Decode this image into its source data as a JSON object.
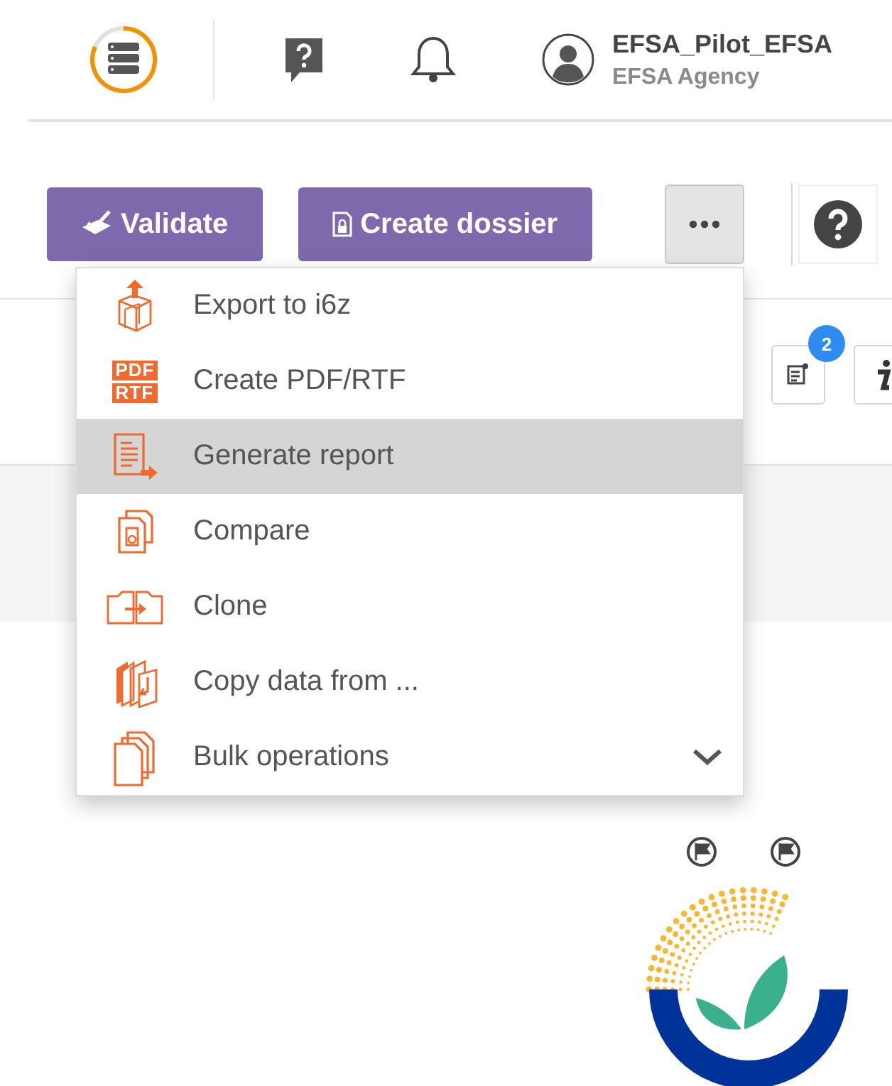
{
  "header": {
    "user_name": "EFSA_Pilot_EFSA",
    "organisation": "EFSA Agency"
  },
  "toolbar": {
    "buttons": [
      {
        "label": "Validate",
        "kind": "validate"
      },
      {
        "label": "Create dossier",
        "kind": "dossier"
      }
    ]
  },
  "side_tools": {
    "badge": "2"
  },
  "menu": {
    "items": [
      {
        "label": "Export to i6z",
        "kind": "export",
        "selected": false
      },
      {
        "label": "Create PDF/RTF",
        "kind": "pdf",
        "selected": false,
        "icon_lines": [
          "PDF",
          "RTF"
        ]
      },
      {
        "label": "Generate report",
        "kind": "report",
        "selected": true
      },
      {
        "label": "Compare",
        "kind": "compare",
        "selected": false
      },
      {
        "label": "Clone",
        "kind": "clone",
        "selected": false
      },
      {
        "label": "Copy data from ...",
        "kind": "copy",
        "selected": false
      },
      {
        "label": "Bulk operations",
        "kind": "bulk",
        "selected": false,
        "expanded": false
      }
    ]
  }
}
